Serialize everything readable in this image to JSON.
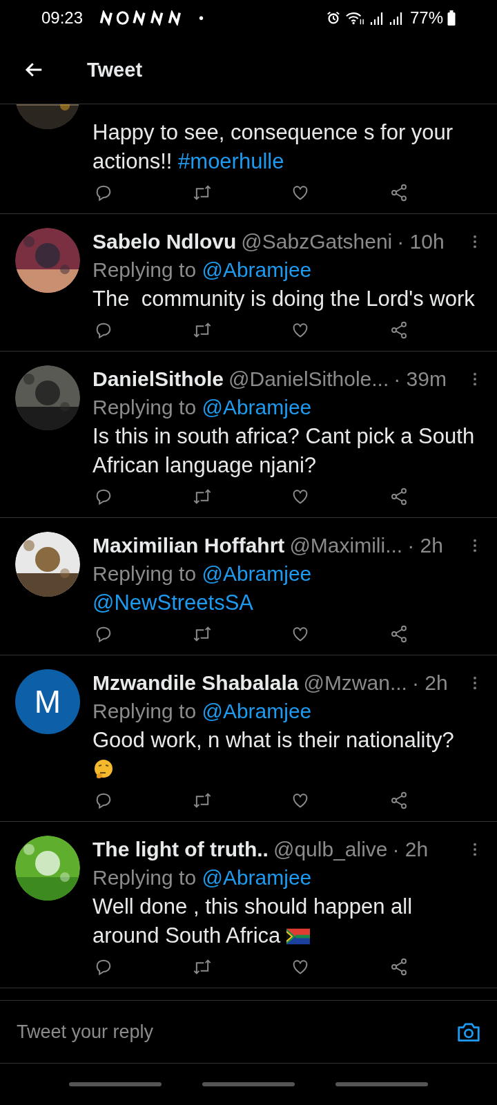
{
  "status_bar": {
    "time": "09:23",
    "dot": "•",
    "battery": "77%"
  },
  "header": {
    "title": "Tweet"
  },
  "tweets": [
    {
      "avatar": {
        "kind": "picture"
      },
      "body": [
        {
          "kind": "text",
          "text": "Happy to see, consequence s for your actions!! "
        },
        {
          "kind": "link",
          "text": "#moerhulle"
        }
      ]
    },
    {
      "name": "Sabelo Ndlovu",
      "handle": "@SabzGatsheni",
      "time": "· 10h",
      "avatar": {
        "kind": "picture"
      },
      "replying_prefix": "Replying to",
      "replying_handle": "@Abramjee",
      "body": [
        {
          "kind": "text",
          "text": "The  community is doing the Lord's work"
        }
      ]
    },
    {
      "name": "DanielSithole",
      "handle": "@DanielSithole...",
      "time": "· 39m",
      "avatar": {
        "kind": "picture"
      },
      "replying_prefix": "Replying to",
      "replying_handle": "@Abramjee",
      "body": [
        {
          "kind": "text",
          "text": "Is this in south africa? Cant pick a South African language njani?"
        }
      ]
    },
    {
      "name": "Maximilian Hoffahrt",
      "handle": "@Maximili...",
      "time": "· 2h",
      "avatar": {
        "kind": "picture"
      },
      "replying_prefix": "Replying to",
      "replying_handle": "@Abramjee",
      "body": [
        {
          "kind": "link",
          "text": "@NewStreetsSA"
        }
      ]
    },
    {
      "name": "Mzwandile Shabalala",
      "handle": "@Mzwan...",
      "time": "· 2h",
      "avatar": {
        "kind": "letter",
        "letter": "M",
        "color": "#0d5fa8"
      },
      "replying_prefix": "Replying to",
      "replying_handle": "@Abramjee",
      "body": [
        {
          "kind": "text",
          "text": "Good work, n what is their nationality? "
        },
        {
          "kind": "thinking"
        }
      ]
    },
    {
      "name": "The light of truth..",
      "handle": "@qulb_alive",
      "time": "· 2h",
      "avatar": {
        "kind": "picture"
      },
      "replying_prefix": "Replying to",
      "replying_handle": "@Abramjee",
      "body": [
        {
          "kind": "text",
          "text": "Well done , this should happen all around South Africa "
        },
        {
          "kind": "flag"
        }
      ]
    }
  ],
  "reply_bar": {
    "placeholder": "Tweet your reply"
  }
}
